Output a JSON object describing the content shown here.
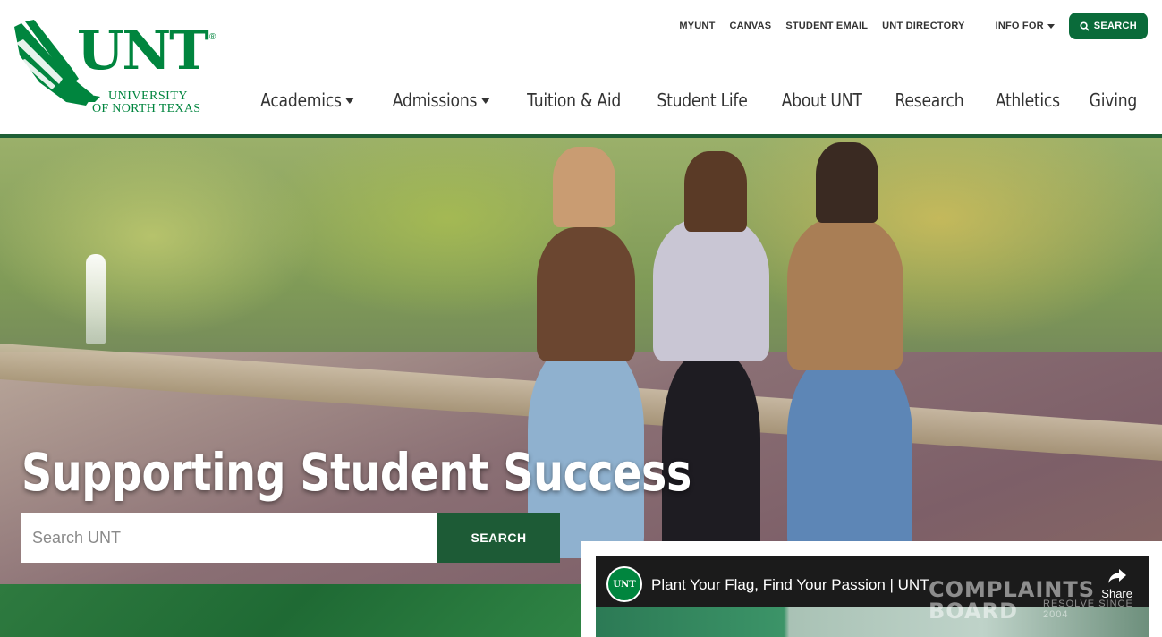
{
  "logo": {
    "word": "UNT",
    "reg": "®",
    "line1": "UNIVERSITY",
    "line2": "OF NORTH TEXAS"
  },
  "utility_nav": {
    "links": [
      "MYUNT",
      "CANVAS",
      "STUDENT EMAIL",
      "UNT DIRECTORY"
    ],
    "info_for": "INFO FOR",
    "search_label": "SEARCH"
  },
  "main_nav": {
    "items": [
      "Academics",
      "Admissions",
      "Tuition & Aid",
      "Student Life",
      "About UNT",
      "Research",
      "Athletics",
      "Giving"
    ]
  },
  "hero": {
    "title": "Supporting Student Success",
    "search_placeholder": "Search UNT",
    "search_button": "SEARCH"
  },
  "video": {
    "channel_badge": "UNT",
    "title": "Plant Your Flag, Find Your Passion | UNT",
    "share_label": "Share",
    "watermark_line1": "COMPLAINTS",
    "watermark_line2": "BOARD",
    "watermark_small": "RESOLVE SINCE 2004"
  },
  "colors": {
    "brand_green": "#00853e",
    "dark_green": "#1d5b36",
    "text_dark": "#333333"
  }
}
